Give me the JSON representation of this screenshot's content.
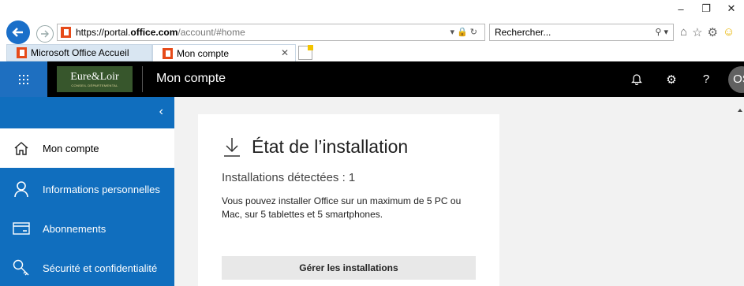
{
  "browser": {
    "url_prefix": "https://portal.",
    "url_host": "office.com",
    "url_path": "/account/#home",
    "search_placeholder": "Rechercher...",
    "tabs": [
      {
        "label": "Microsoft Office Accueil"
      },
      {
        "label": "Mon compte"
      }
    ]
  },
  "header": {
    "brand_name": "Eure&Loir",
    "brand_sub": "CONSEIL DÉPARTEMENTAL",
    "app_title": "Mon compte",
    "avatar_initials": "OS",
    "help_label": "?"
  },
  "sidebar": {
    "items": [
      {
        "label": "Mon compte",
        "icon": "home-icon"
      },
      {
        "label": "Informations personnelles",
        "icon": "person-icon"
      },
      {
        "label": "Abonnements",
        "icon": "card-icon"
      },
      {
        "label": "Sécurité et confidentialité",
        "icon": "key-icon"
      }
    ]
  },
  "card": {
    "title": "État de l’installation",
    "detected": "Installations détectées : 1",
    "description": "Vous pouvez installer Office sur un maximum de 5 PC ou Mac, sur 5 tablettes et 5 smartphones.",
    "button": "Gérer les installations"
  },
  "colors": {
    "accent": "#106ebe",
    "header_bg": "#000000",
    "brand_bg": "#37562c"
  }
}
